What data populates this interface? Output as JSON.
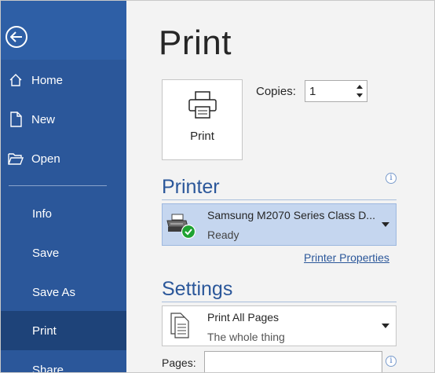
{
  "sidebar": {
    "back_label": "",
    "items": [
      {
        "label": "Home",
        "icon": "home-icon"
      },
      {
        "label": "New",
        "icon": "new-document-icon"
      },
      {
        "label": "Open",
        "icon": "open-folder-icon"
      },
      {
        "label": "Info"
      },
      {
        "label": "Save"
      },
      {
        "label": "Save As"
      },
      {
        "label": "Print",
        "active": true
      },
      {
        "label": "Share"
      }
    ],
    "colors": {
      "background": "#2b579a",
      "active": "#1e4379"
    }
  },
  "main": {
    "title": "Print",
    "print_button_label": "Print",
    "copies": {
      "label": "Copies:",
      "value": "1"
    },
    "printer": {
      "heading": "Printer",
      "name": "Samsung M2070 Series Class D...",
      "status": "Ready",
      "properties_link": "Printer Properties",
      "info_icon": "i"
    },
    "settings": {
      "heading": "Settings",
      "selected": "Print All Pages",
      "description": "The whole thing",
      "pages_label": "Pages:",
      "pages_value": "",
      "info_icon": "i"
    }
  }
}
